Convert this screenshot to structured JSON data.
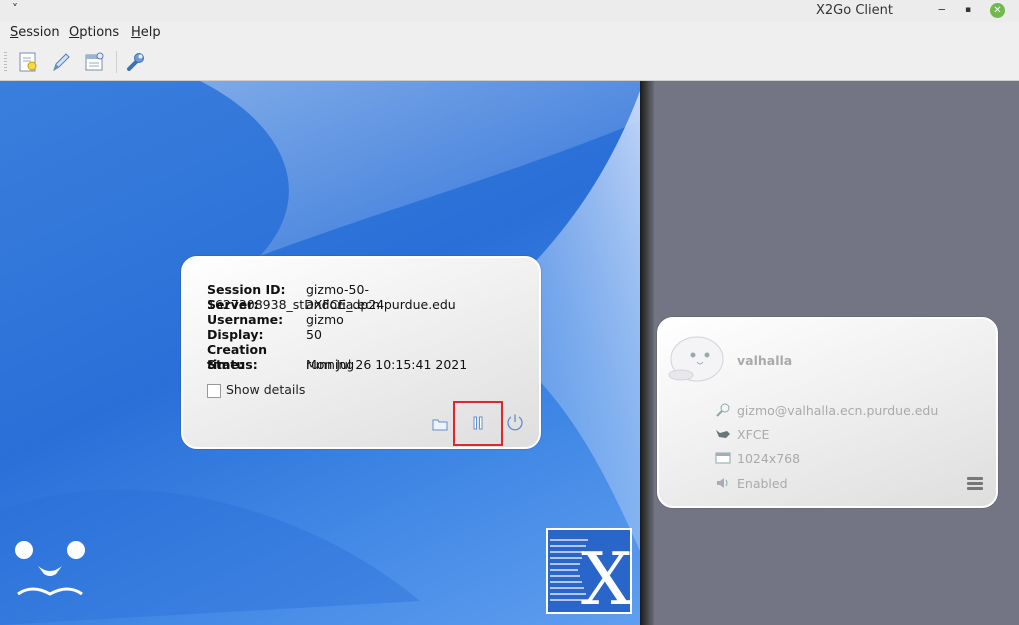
{
  "window": {
    "title": "X2Go Client",
    "menu_glyph": "˅",
    "minimize": "‒",
    "restore": "▪",
    "close": "✕"
  },
  "menu": {
    "session": {
      "mnemonic": "S",
      "rest": "ession"
    },
    "options": {
      "mnemonic": "O",
      "rest": "ptions"
    },
    "help": {
      "mnemonic": "H",
      "rest": "elp"
    }
  },
  "toolbar": {
    "icons": [
      "new-session-icon",
      "edit-session-icon",
      "session-manager-icon",
      "settings-wrench-icon"
    ]
  },
  "session": {
    "rows": [
      {
        "key": "Session ID:",
        "value": "gizmo-50-1627308938_stDXFCE_dp24"
      },
      {
        "key": "Server:",
        "value": "andoria.ecn.purdue.edu"
      },
      {
        "key": "Username:",
        "value": "gizmo"
      },
      {
        "key": "Display:",
        "value": "50"
      },
      {
        "key": "Creation time:",
        "value": "Mon Jul 26 10:15:41 2021"
      },
      {
        "key": "Status:",
        "value": "running"
      }
    ],
    "show_details_label": "Show details",
    "show_details_checked": false,
    "highlight_color": "#e0282a"
  },
  "server": {
    "name": "valhalla",
    "login": "gizmo@valhalla.ecn.purdue.edu",
    "desktop": "XFCE",
    "resolution": "1024x768",
    "sound": "Enabled"
  },
  "colors": {
    "accent_blue": "#2a6fd8",
    "right_panel": "#737584",
    "titlebar_close": "#6fba4b"
  }
}
